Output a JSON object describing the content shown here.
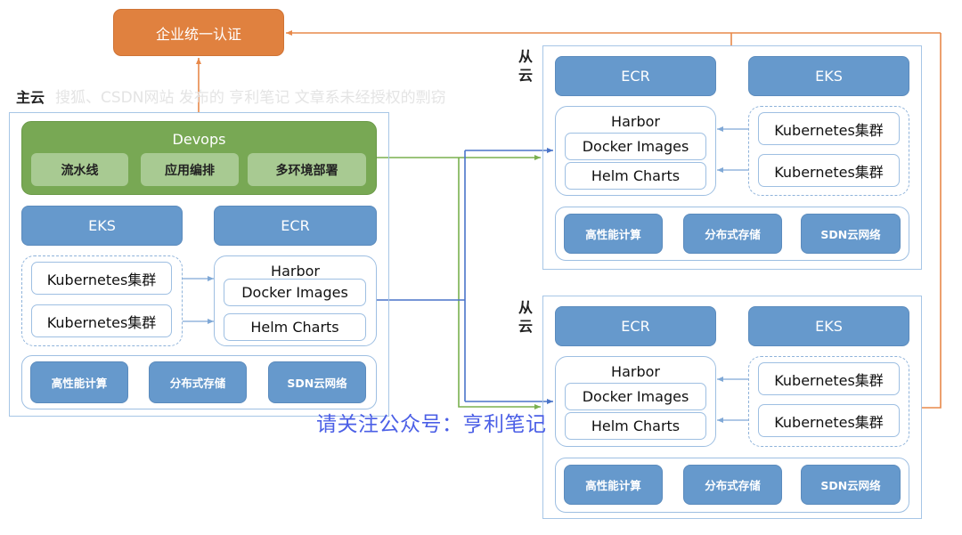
{
  "auth": {
    "label": "企业统一认证"
  },
  "watermarks": {
    "gray": "搜狐、CSDN网站 发布的 亨利笔记 文章系未经授权的剽窃",
    "blue": "请关注公众号：亨利笔记"
  },
  "main_cloud": {
    "label": "主云",
    "devops": {
      "title": "Devops",
      "items": [
        "流水线",
        "应用编排",
        "多环境部署"
      ]
    },
    "eks": "EKS",
    "ecr": "ECR",
    "k8s_clusters": [
      "Kubernetes集群",
      "Kubernetes集群"
    ],
    "harbor": {
      "title": "Harbor",
      "items": [
        "Docker Images",
        "Helm Charts"
      ]
    },
    "infra": [
      "高性能计算",
      "分布式存储",
      "SDN云网络"
    ]
  },
  "slave_clouds": [
    {
      "label": "从云",
      "ecr": "ECR",
      "eks": "EKS",
      "harbor": {
        "title": "Harbor",
        "items": [
          "Docker Images",
          "Helm Charts"
        ]
      },
      "k8s_clusters": [
        "Kubernetes集群",
        "Kubernetes集群"
      ],
      "infra": [
        "高性能计算",
        "分布式存储",
        "SDN云网络"
      ]
    },
    {
      "label": "从云",
      "ecr": "ECR",
      "eks": "EKS",
      "harbor": {
        "title": "Harbor",
        "items": [
          "Docker Images",
          "Helm Charts"
        ]
      },
      "k8s_clusters": [
        "Kubernetes集群",
        "Kubernetes集群"
      ],
      "infra": [
        "高性能计算",
        "分布式存储",
        "SDN云网络"
      ]
    }
  ],
  "colors": {
    "auth_orange": "#e0813f",
    "devops_green": "#78a854",
    "service_blue": "#6699cc",
    "auth_link": "#e8894a",
    "devops_link": "#7ab04f",
    "image_sync_link": "#4a74c9",
    "watermark_blue": "#4b5fe6"
  }
}
